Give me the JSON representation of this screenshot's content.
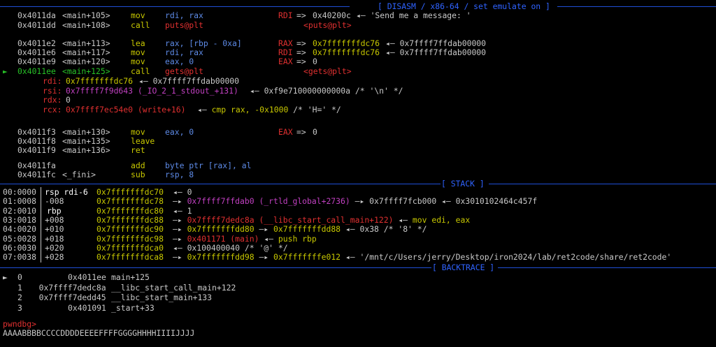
{
  "colors": {
    "background": "#000000",
    "header": "#2f63ff",
    "yellow": "#c8c800",
    "red": "#e03030",
    "magenta": "#c040c0",
    "green": "#27c127",
    "blue": "#5d8ae6"
  },
  "disasm": {
    "header_title": "[ DISASM / x86-64 / set emulate on ]",
    "lines": [
      {
        "addr": "0x4011da",
        "sym": "<main+105>",
        "mn": "mov",
        "ops": "rdi, rax",
        "anno_reg": "RDI",
        "anno_arrow": "=>",
        "anno_val": "0x40200c",
        "anno_tail": "◂— 'Send me a message: '"
      },
      {
        "addr": "0x4011dd",
        "sym": "<main+108>",
        "mn": "call",
        "ops": "puts@plt",
        "anno_sym": "<puts@plt>"
      },
      {
        "addr": "0x4011e2",
        "sym": "<main+113>",
        "mn": "lea",
        "ops": "rax, [rbp - 0xa]",
        "anno_reg": "RAX",
        "anno_arrow": "=>",
        "anno_val": "0x7fffffffdc76",
        "anno_tail": "◂— 0x7ffff7ffdab00000"
      },
      {
        "addr": "0x4011e6",
        "sym": "<main+117>",
        "mn": "mov",
        "ops": "rdi, rax",
        "anno_reg": "RDI",
        "anno_arrow": "=>",
        "anno_val": "0x7fffffffdc76",
        "anno_tail": "◂— 0x7ffff7ffdab00000"
      },
      {
        "addr": "0x4011e9",
        "sym": "<main+120>",
        "mn": "mov",
        "ops": "eax, 0",
        "anno_reg": "EAX",
        "anno_arrow": "=>",
        "anno_val": "0"
      },
      {
        "marker": "►",
        "addr": "0x4011ee",
        "sym": "<main+125>",
        "mn": "call",
        "ops": "gets@plt",
        "anno_sym": "<gets@plt>"
      },
      {
        "addr": "0x4011f3",
        "sym": "<main+130>",
        "mn": "mov",
        "ops": "eax, 0",
        "anno_reg": "EAX",
        "anno_arrow": "=>",
        "anno_val": "0"
      },
      {
        "addr": "0x4011f8",
        "sym": "<main+135>",
        "mn": "leave",
        "ops": ""
      },
      {
        "addr": "0x4011f9",
        "sym": "<main+136>",
        "mn": "ret",
        "ops": ""
      },
      {
        "addr": "0x4011fa",
        "sym": "",
        "mn": "add",
        "ops": "byte ptr [rax], al"
      },
      {
        "addr": "0x4011fc",
        "sym": "<_fini>",
        "mn": "sub",
        "ops": "rsp, 8"
      }
    ],
    "args": {
      "rdi": {
        "name": "rdi:",
        "val": "0x7fffffffdc76",
        "tail": "◂— 0x7ffff7ffdab00000"
      },
      "rsi": {
        "name": "rsi:",
        "val": "0x7ffff7f9d643 (_IO_2_1_stdout_+131)",
        "tail": "◂— 0xf9e710000000000a /* '\\n' */"
      },
      "rdx": {
        "name": "rdx:",
        "val": "0"
      },
      "rcx": {
        "name": "rcx:",
        "val": "0x7ffff7ec54e0 (write+16)",
        "arrow": "◂—",
        "ins": "cmp rax, -0x1000",
        "tail": "/* 'H=' */"
      }
    }
  },
  "stack": {
    "header_title": "[ STACK ]",
    "rows": [
      {
        "idx": "00:0000",
        "regs": "rsp rdi-6",
        "addr": "0x7fffffffdc70",
        "rest": [
          [
            "◂— 0",
            "w"
          ]
        ]
      },
      {
        "idx": "01:0008",
        "regs": "-008",
        "addr": "0x7fffffffdc78",
        "rest": [
          [
            "—▸ ",
            "w"
          ],
          [
            "0x7ffff7ffdab0 (_rtld_global+2736)",
            "m"
          ],
          [
            " —▸ 0x7ffff7fcb000 ◂— 0x3010102464c457f",
            "w"
          ]
        ]
      },
      {
        "idx": "02:0010",
        "regs": "rbp",
        "addr": "0x7fffffffdc80",
        "rest": [
          [
            "◂— 1",
            "w"
          ]
        ]
      },
      {
        "idx": "03:0018",
        "regs": "+008",
        "addr": "0x7fffffffdc88",
        "rest": [
          [
            "—▸ ",
            "w"
          ],
          [
            "0x7ffff7dedc8a (__libc_start_call_main+122)",
            "r"
          ],
          [
            " ◂— ",
            "w"
          ],
          [
            "mov edi, eax",
            "y"
          ]
        ]
      },
      {
        "idx": "04:0020",
        "regs": "+010",
        "addr": "0x7fffffffdc90",
        "rest": [
          [
            "—▸ ",
            "w"
          ],
          [
            "0x7fffffffdd80",
            "y"
          ],
          [
            " —▸ ",
            "w"
          ],
          [
            "0x7fffffffdd88",
            "y"
          ],
          [
            " ◂— 0x38 /* '8' */",
            "w"
          ]
        ]
      },
      {
        "idx": "05:0028",
        "regs": "+018",
        "addr": "0x7fffffffdc98",
        "rest": [
          [
            "—▸ ",
            "w"
          ],
          [
            "0x401171 (main)",
            "r"
          ],
          [
            " ◂— ",
            "w"
          ],
          [
            "push rbp",
            "y"
          ]
        ]
      },
      {
        "idx": "06:0030",
        "regs": "+020",
        "addr": "0x7fffffffdca0",
        "rest": [
          [
            "◂— 0x100400040 /* '@' */",
            "w"
          ]
        ]
      },
      {
        "idx": "07:0038",
        "regs": "+028",
        "addr": "0x7fffffffdca8",
        "rest": [
          [
            "—▸ ",
            "w"
          ],
          [
            "0x7fffffffdd98",
            "y"
          ],
          [
            " —▸ ",
            "w"
          ],
          [
            "0x7fffffffe012",
            "y"
          ],
          [
            " ◂— '/mnt/c/Users/jerry/Desktop/iron2024/lab/ret2code/share/ret2code'",
            "w"
          ]
        ]
      }
    ]
  },
  "backtrace": {
    "header_title": "[ BACKTRACE ]",
    "rows": [
      {
        "marker": "►",
        "num": "0",
        "addr": "0x4011ee",
        "sym": "main+125"
      },
      {
        "marker": "",
        "num": "1",
        "addr": "0x7ffff7dedc8a",
        "sym": "__libc_start_call_main+122"
      },
      {
        "marker": "",
        "num": "2",
        "addr": "0x7ffff7dedd45",
        "sym": "__libc_start_main+133"
      },
      {
        "marker": "",
        "num": "3",
        "addr": "0x401091",
        "sym": "_start+33"
      }
    ]
  },
  "prompt": {
    "label": "pwndbg>",
    "input": "AAAABBBBCCCCDDDDEEEEFFFFGGGGHHHHIIIIJJJJ"
  }
}
